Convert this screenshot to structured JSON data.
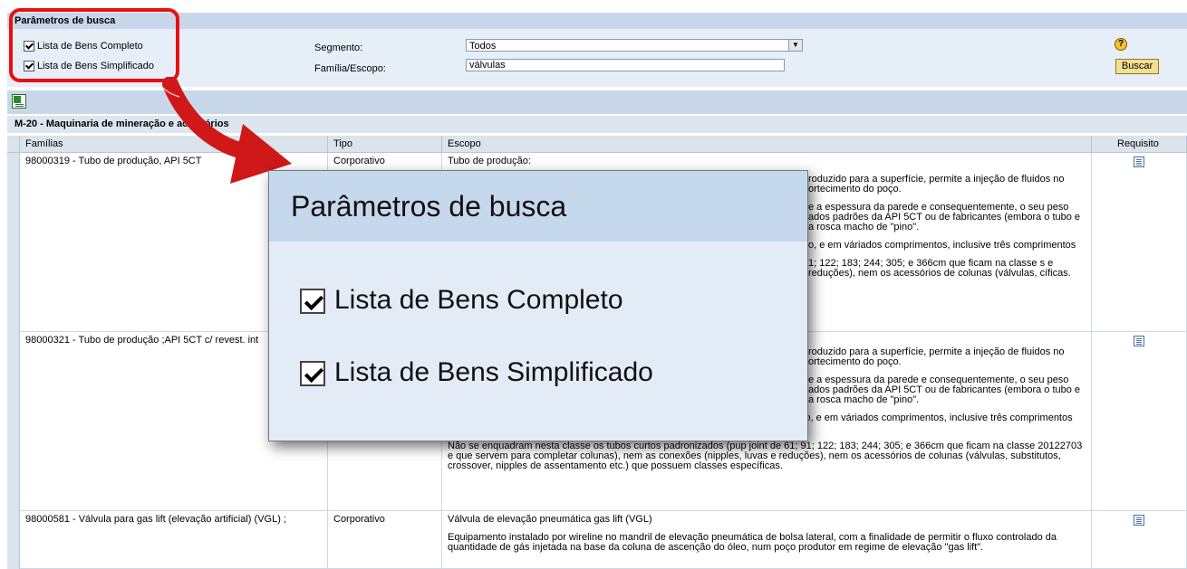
{
  "search_params": {
    "title": "Parâmetros de busca",
    "checkbox_completo": "Lista de Bens Completo",
    "checkbox_simplificado": "Lista de Bens Simplificado",
    "segmento_label": "Segmento:",
    "segmento_value": "Todos",
    "familia_label": "Família/Escopo:",
    "familia_value": "válvulas",
    "buscar": "Buscar",
    "help_icon": "help-icon"
  },
  "category": "M-20 - Maquinaria de mineração e acessórios",
  "table": {
    "headers": [
      "Famílias",
      "Tipo",
      "Escopo",
      "Requisito"
    ],
    "rows": [
      {
        "familia": "98000319 - Tubo de produção, API 5CT",
        "tipo": "Corporativo",
        "escopo": [
          "Tubo de produção:",
          "roduzido para a superfície, permite a injeção de fluidos no ortecimento do poço.",
          "e a espessura da parede e consequentemente, o seu peso ados padrões da API 5CT ou de fabricantes (embora o tubo e a rosca macho de \"pino\".",
          "o, e em váriados comprimentos, inclusive três comprimentos",
          "1; 122; 183; 244; 305; e 366cm que ficam na classe s e reduções), nem os acessórios de colunas (válvulas, cíficas."
        ]
      },
      {
        "familia": "98000321 - Tubo de produção ;API 5CT c/ revest. int",
        "tipo": "",
        "escopo": [
          "roduzido para a superfície, permite a injeção de fluidos no ortecimento do poço.",
          "e a espessura da parede e consequentemente, o seu peso ados padrões da API 5CT ou de fabricantes (embora o tubo e a rosca macho de \"pino\".",
          "Os tubos podem ser adquiridos com ou sem luva, com revestimento termoplástico, e em váriados comprimentos, inclusive três comprimentos randômicos padronizados.",
          "Não se enquadram nesta classe os tubos curtos padronizados (pup joint de 61; 91; 122; 183; 244; 305; e 366cm que ficam na classe 20122703 e que servem para completar colunas), nem as conexões (nipples, luvas e reduções), nem os acessórios de colunas (válvulas, substitutos, crossover, nipples de assentamento etc.) que possuem classes específicas."
        ]
      },
      {
        "familia": "98000581 - Válvula para gas lift (elevação artificial) (VGL) ;",
        "tipo": "Corporativo",
        "escopo": [
          "Válvula de elevação pneumática gas lift (VGL)",
          "Equipamento instalado por wireline no mandril de elevação pneumática de bolsa lateral, com a finalidade de permitir o fluxo controlado da quantidade de gás injetada na base da coluna de ascenção do óleo, num poço produtor em regime de elevação \"gas lift\"."
        ]
      }
    ]
  },
  "zoom": {
    "title": "Parâmetros de busca",
    "item1": "Lista de Bens Completo",
    "item2": "Lista de Bens Simplificado"
  },
  "colors": {
    "highlight": "#e81010",
    "header_bg": "#c8d8ea",
    "panel_bg": "#e6eef7"
  }
}
